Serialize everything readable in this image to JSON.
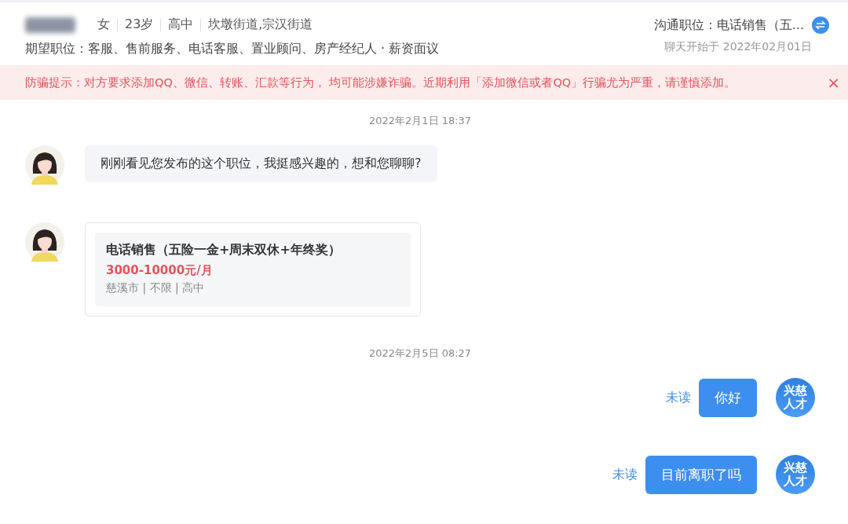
{
  "candidate": {
    "tags": [
      "女",
      "23岁",
      "高中",
      "坎墩街道,宗汉街道"
    ],
    "expectation": "期望职位：客服、售前服务、电话客服、置业顾问、房产经纪人 · 薪资面议",
    "position": "沟通职位：电话销售（五...",
    "chat_started": "聊天开始于 2022年02月01日"
  },
  "warning": {
    "text": "防骗提示：对方要求添加QQ、微信、转账、汇款等行为， 均可能涉嫌诈骗。近期利用「添加微信或者QQ」行骗尤为严重，请谨慎添加。",
    "close": "×"
  },
  "messages": [
    {
      "kind": "timestamp",
      "text": "2022年2月1日 18:37"
    },
    {
      "kind": "incoming",
      "text": "刚刚看见您发布的这个职位，我挺感兴趣的，想和您聊聊?"
    },
    {
      "kind": "job_card",
      "title": "电话销售（五险一金+周末双休+年终奖）",
      "salary": "3000-10000元/月",
      "details": "慈溪市 | 不限 | 高中"
    },
    {
      "kind": "timestamp",
      "text": "2022年2月5日 08:27"
    },
    {
      "kind": "outgoing",
      "text": "你好",
      "status": "未读",
      "logo": [
        "兴慈",
        "人才"
      ]
    },
    {
      "kind": "outgoing",
      "text": "目前离职了吗",
      "status": "未读",
      "logo": [
        "兴慈",
        "人才"
      ]
    }
  ]
}
